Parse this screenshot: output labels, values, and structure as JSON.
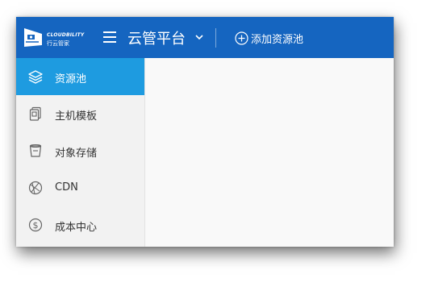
{
  "brand": {
    "name_en": "CLOUDBILITY",
    "name_cn": "行云管家"
  },
  "header": {
    "platform_title": "云管平台",
    "add_pool_label": "添加资源池"
  },
  "sidebar": {
    "items": [
      {
        "label": "资源池",
        "icon": "layers-icon",
        "active": true
      },
      {
        "label": "主机模板",
        "icon": "host-template-icon",
        "active": false
      },
      {
        "label": "对象存储",
        "icon": "bucket-icon",
        "active": false
      },
      {
        "label": "CDN",
        "icon": "globe-icon",
        "active": false
      },
      {
        "label": "成本中心",
        "icon": "dollar-icon",
        "active": false
      }
    ]
  },
  "colors": {
    "topbar": "#1565c0",
    "active_nav": "#1e9be0",
    "sidebar_bg": "#f2f2f2",
    "main_bg": "#f9f9f9"
  }
}
